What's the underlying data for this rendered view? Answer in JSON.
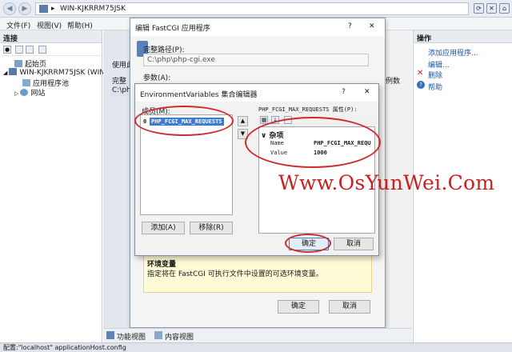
{
  "address": {
    "path": "WIN-KJKRRM75JSK",
    "sep": "▸"
  },
  "menu": [
    "文件(F)",
    "视图(V)",
    "帮助(H)"
  ],
  "left_panel": {
    "title": "连接",
    "tree": [
      "起始页",
      "WIN-KJKRRM75JSK (WIN-",
      "应用程序池",
      "网站"
    ]
  },
  "center_partial": {
    "use_text": "使用此",
    "full_text": "完整",
    "path_cell": "C:\\php",
    "count_col": "例数"
  },
  "right_panel": {
    "title": "操作",
    "links": [
      "添加应用程序...",
      "编辑...",
      "删除",
      "帮助"
    ]
  },
  "fastcgi_dialog": {
    "title": "编辑 FastCGI 应用程序",
    "help": "?",
    "close": "✕",
    "full_path_label": "完整路径(P):",
    "full_path_value": "C:\\php\\php-cgi.exe",
    "args_label": "参数(A):",
    "info_title": "环境变量",
    "info_desc": "指定将在 FastCGI 可执行文件中设置的可选环境变量。",
    "ok": "确定",
    "cancel": "取消"
  },
  "env_dialog": {
    "title": "EnvironmentVariables 集合编辑器",
    "help": "?",
    "close": "✕",
    "members_label": "成员(M):",
    "member_index": "0",
    "member_name": "PHP_FCGI_MAX_REQUESTS",
    "props_label": "PHP_FCGI_MAX_REQUESTS 属性(P):",
    "category": "杂项",
    "props": [
      {
        "name": "Name",
        "value": "PHP_FCGI_MAX_REQU"
      },
      {
        "name": "Value",
        "value": "1000"
      }
    ],
    "add": "添加(A)",
    "remove": "移除(R)",
    "ok": "确定",
    "cancel": "取消"
  },
  "bottom_tabs": [
    "功能视图",
    "内容视图"
  ],
  "status": "配置:\"localhost\" applicationHost.config",
  "watermark": "Www.OsYunWei.Com",
  "colors": {
    "annotation": "#d02a2a",
    "selection": "#3a7bd5"
  }
}
